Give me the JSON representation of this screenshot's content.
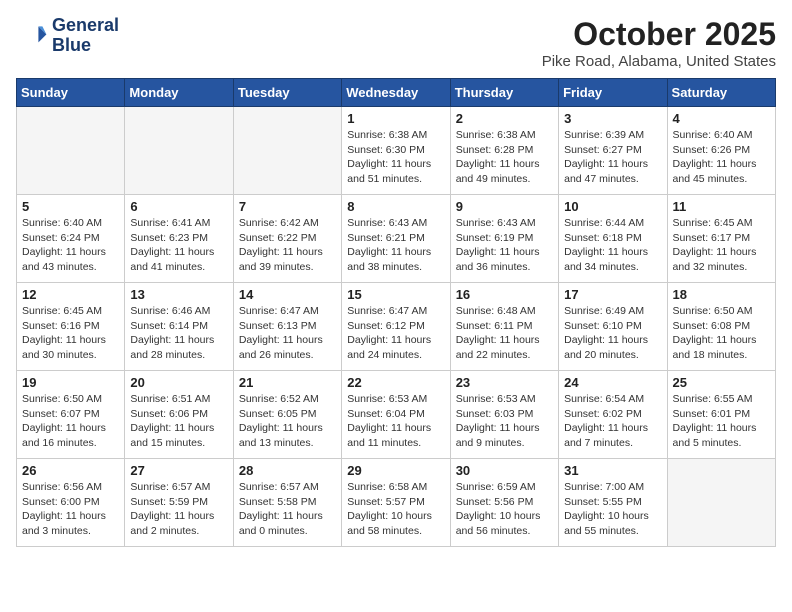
{
  "header": {
    "logo_line1": "General",
    "logo_line2": "Blue",
    "month": "October 2025",
    "location": "Pike Road, Alabama, United States"
  },
  "weekdays": [
    "Sunday",
    "Monday",
    "Tuesday",
    "Wednesday",
    "Thursday",
    "Friday",
    "Saturday"
  ],
  "weeks": [
    [
      {
        "day": "",
        "info": ""
      },
      {
        "day": "",
        "info": ""
      },
      {
        "day": "",
        "info": ""
      },
      {
        "day": "1",
        "info": "Sunrise: 6:38 AM\nSunset: 6:30 PM\nDaylight: 11 hours\nand 51 minutes."
      },
      {
        "day": "2",
        "info": "Sunrise: 6:38 AM\nSunset: 6:28 PM\nDaylight: 11 hours\nand 49 minutes."
      },
      {
        "day": "3",
        "info": "Sunrise: 6:39 AM\nSunset: 6:27 PM\nDaylight: 11 hours\nand 47 minutes."
      },
      {
        "day": "4",
        "info": "Sunrise: 6:40 AM\nSunset: 6:26 PM\nDaylight: 11 hours\nand 45 minutes."
      }
    ],
    [
      {
        "day": "5",
        "info": "Sunrise: 6:40 AM\nSunset: 6:24 PM\nDaylight: 11 hours\nand 43 minutes."
      },
      {
        "day": "6",
        "info": "Sunrise: 6:41 AM\nSunset: 6:23 PM\nDaylight: 11 hours\nand 41 minutes."
      },
      {
        "day": "7",
        "info": "Sunrise: 6:42 AM\nSunset: 6:22 PM\nDaylight: 11 hours\nand 39 minutes."
      },
      {
        "day": "8",
        "info": "Sunrise: 6:43 AM\nSunset: 6:21 PM\nDaylight: 11 hours\nand 38 minutes."
      },
      {
        "day": "9",
        "info": "Sunrise: 6:43 AM\nSunset: 6:19 PM\nDaylight: 11 hours\nand 36 minutes."
      },
      {
        "day": "10",
        "info": "Sunrise: 6:44 AM\nSunset: 6:18 PM\nDaylight: 11 hours\nand 34 minutes."
      },
      {
        "day": "11",
        "info": "Sunrise: 6:45 AM\nSunset: 6:17 PM\nDaylight: 11 hours\nand 32 minutes."
      }
    ],
    [
      {
        "day": "12",
        "info": "Sunrise: 6:45 AM\nSunset: 6:16 PM\nDaylight: 11 hours\nand 30 minutes."
      },
      {
        "day": "13",
        "info": "Sunrise: 6:46 AM\nSunset: 6:14 PM\nDaylight: 11 hours\nand 28 minutes."
      },
      {
        "day": "14",
        "info": "Sunrise: 6:47 AM\nSunset: 6:13 PM\nDaylight: 11 hours\nand 26 minutes."
      },
      {
        "day": "15",
        "info": "Sunrise: 6:47 AM\nSunset: 6:12 PM\nDaylight: 11 hours\nand 24 minutes."
      },
      {
        "day": "16",
        "info": "Sunrise: 6:48 AM\nSunset: 6:11 PM\nDaylight: 11 hours\nand 22 minutes."
      },
      {
        "day": "17",
        "info": "Sunrise: 6:49 AM\nSunset: 6:10 PM\nDaylight: 11 hours\nand 20 minutes."
      },
      {
        "day": "18",
        "info": "Sunrise: 6:50 AM\nSunset: 6:08 PM\nDaylight: 11 hours\nand 18 minutes."
      }
    ],
    [
      {
        "day": "19",
        "info": "Sunrise: 6:50 AM\nSunset: 6:07 PM\nDaylight: 11 hours\nand 16 minutes."
      },
      {
        "day": "20",
        "info": "Sunrise: 6:51 AM\nSunset: 6:06 PM\nDaylight: 11 hours\nand 15 minutes."
      },
      {
        "day": "21",
        "info": "Sunrise: 6:52 AM\nSunset: 6:05 PM\nDaylight: 11 hours\nand 13 minutes."
      },
      {
        "day": "22",
        "info": "Sunrise: 6:53 AM\nSunset: 6:04 PM\nDaylight: 11 hours\nand 11 minutes."
      },
      {
        "day": "23",
        "info": "Sunrise: 6:53 AM\nSunset: 6:03 PM\nDaylight: 11 hours\nand 9 minutes."
      },
      {
        "day": "24",
        "info": "Sunrise: 6:54 AM\nSunset: 6:02 PM\nDaylight: 11 hours\nand 7 minutes."
      },
      {
        "day": "25",
        "info": "Sunrise: 6:55 AM\nSunset: 6:01 PM\nDaylight: 11 hours\nand 5 minutes."
      }
    ],
    [
      {
        "day": "26",
        "info": "Sunrise: 6:56 AM\nSunset: 6:00 PM\nDaylight: 11 hours\nand 3 minutes."
      },
      {
        "day": "27",
        "info": "Sunrise: 6:57 AM\nSunset: 5:59 PM\nDaylight: 11 hours\nand 2 minutes."
      },
      {
        "day": "28",
        "info": "Sunrise: 6:57 AM\nSunset: 5:58 PM\nDaylight: 11 hours\nand 0 minutes."
      },
      {
        "day": "29",
        "info": "Sunrise: 6:58 AM\nSunset: 5:57 PM\nDaylight: 10 hours\nand 58 minutes."
      },
      {
        "day": "30",
        "info": "Sunrise: 6:59 AM\nSunset: 5:56 PM\nDaylight: 10 hours\nand 56 minutes."
      },
      {
        "day": "31",
        "info": "Sunrise: 7:00 AM\nSunset: 5:55 PM\nDaylight: 10 hours\nand 55 minutes."
      },
      {
        "day": "",
        "info": ""
      }
    ]
  ]
}
